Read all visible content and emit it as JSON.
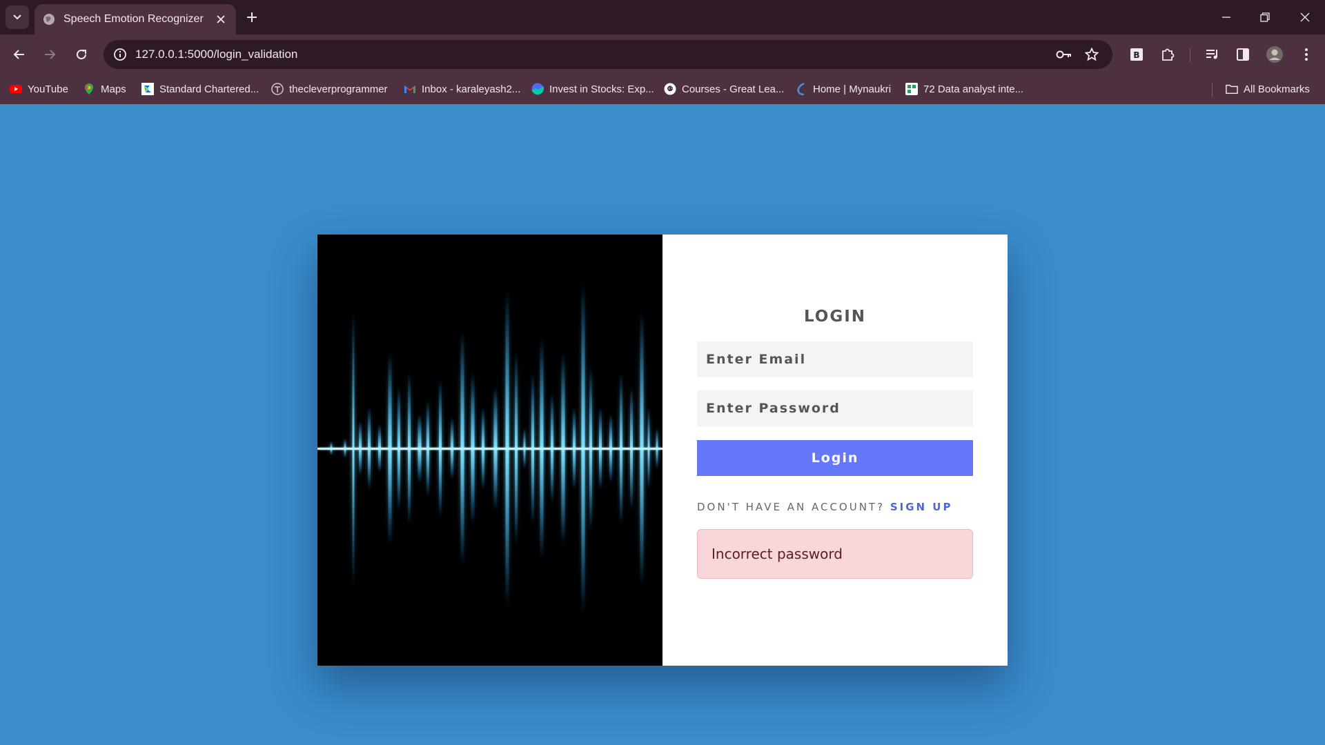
{
  "browser": {
    "tab": {
      "title": "Speech Emotion Recognizer"
    },
    "url": "127.0.0.1:5000/login_validation",
    "bookmarks": [
      {
        "label": "YouTube",
        "icon": "youtube-icon",
        "color": "#ff0000"
      },
      {
        "label": "Maps",
        "icon": "maps-icon",
        "color": "#34a853"
      },
      {
        "label": "Standard Chartered...",
        "icon": "standard-chartered-icon",
        "color": "#38d200"
      },
      {
        "label": "thecleverprogrammer",
        "icon": "thecleverprogrammer-icon",
        "color": "#cccccc"
      },
      {
        "label": "Inbox - karaleyash2...",
        "icon": "gmail-icon",
        "color": "#ea4335"
      },
      {
        "label": "Invest in Stocks: Exp...",
        "icon": "groww-icon",
        "color": "#5367ff"
      },
      {
        "label": "Courses - Great Lea...",
        "icon": "google-icon",
        "color": "#ffffff"
      },
      {
        "label": "Home | Mynaukri",
        "icon": "naukri-icon",
        "color": "#4a90e2"
      },
      {
        "label": "72 Data analyst inte...",
        "icon": "sheet-icon",
        "color": "#1ea362"
      }
    ],
    "all_bookmarks": "All Bookmarks"
  },
  "login": {
    "title": "LOGIN",
    "email_placeholder": "Enter Email",
    "password_placeholder": "Enter Password",
    "button": "Login",
    "no_account": "DON'T HAVE AN ACCOUNT?",
    "signup": "SIGN UP",
    "error": "Incorrect password"
  },
  "colors": {
    "page_bg": "#3a8ccb",
    "button": "#6478f8",
    "alert_bg": "#f8d7da",
    "wave": "#5fd8ff"
  }
}
